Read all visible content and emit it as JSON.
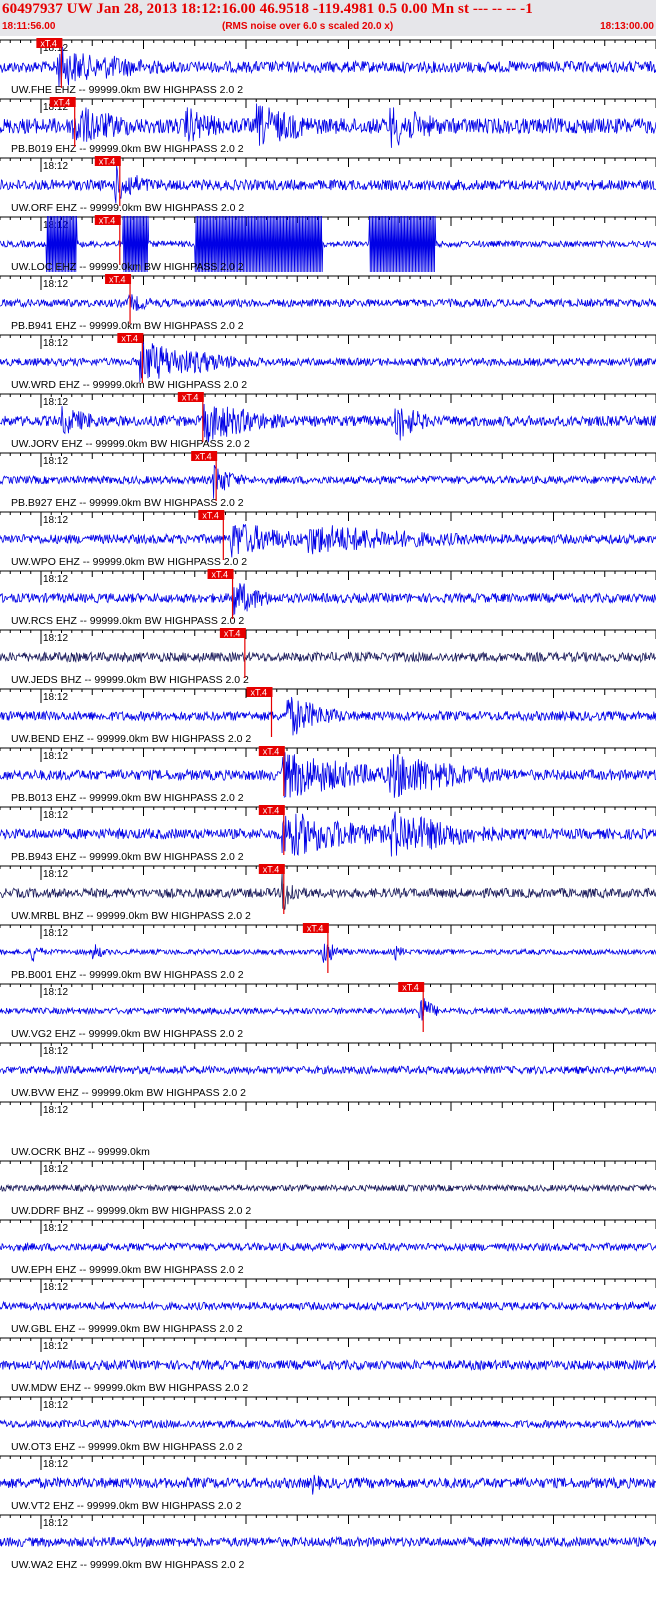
{
  "header": {
    "title": "60497937 UW Jan 28, 2013 18:12:16.00   46.9518 -119.4981  0.5 0.00 Mn st --- -- -- -1",
    "time_start": "18:11:56.00",
    "rms_note": "(RMS noise over 6.0 s scaled 20.0 x)",
    "time_end": "18:13:00.00"
  },
  "chart_data": {
    "type": "line",
    "time_range": [
      "18:11:56.00",
      "18:13:00.00"
    ],
    "minute_label": "18:12",
    "pick_label": "xT.4",
    "colors": {
      "trace": "#0000e6",
      "trace_dark": "#1a1a5a",
      "pick": "#e60000",
      "axis": "#000000"
    },
    "traces": [
      {
        "label": "UW.FHE EHZ -- 99999.0km BW  HIGHPASS  2.0  2",
        "pick_s": 5.5,
        "noise": 0.22,
        "bursts": [
          [
            5.5,
            5,
            0.9
          ],
          [
            10,
            8,
            0.5
          ]
        ],
        "color": "trace"
      },
      {
        "label": "PB.B019 EHZ -- 99999.0km BW  HIGHPASS  2.0  2",
        "pick_s": 6.8,
        "noise": 0.3,
        "bursts": [
          [
            7,
            6,
            0.9
          ],
          [
            18,
            4,
            0.8
          ],
          [
            25,
            6,
            0.9
          ],
          [
            38,
            5,
            0.9
          ]
        ],
        "color": "trace"
      },
      {
        "label": "UW.ORF EHZ -- 99999.0km BW  HIGHPASS  2.0  2",
        "pick_s": 11.2,
        "noise": 0.2,
        "bursts": [
          [
            11.2,
            3,
            0.8
          ]
        ],
        "color": "trace"
      },
      {
        "label": "UW.LOC EHZ -- 99999.0km BW  HIGHPASS  2.0  2",
        "pick_s": 11.2,
        "noise": 0.12,
        "bursts": [],
        "saturated": [
          [
            4.5,
            7.5
          ],
          [
            12.0,
            14.5
          ],
          [
            19.0,
            31.5
          ],
          [
            36.0,
            42.5
          ]
        ],
        "color": "trace"
      },
      {
        "label": "PB.B941 EHZ -- 99999.0km BW  HIGHPASS  2.0  2",
        "pick_s": 12.2,
        "noise": 0.15,
        "bursts": [
          [
            12.5,
            3,
            0.4
          ]
        ],
        "color": "trace"
      },
      {
        "label": "UW.WRD EHZ -- 99999.0km BW  HIGHPASS  2.0  2",
        "pick_s": 13.4,
        "noise": 0.15,
        "bursts": [
          [
            13.6,
            7,
            0.9
          ],
          [
            19,
            5,
            0.5
          ]
        ],
        "color": "trace"
      },
      {
        "label": "UW.JORV EHZ -- 99999.0km BW  HIGHPASS  2.0  2",
        "pick_s": 19.3,
        "noise": 0.2,
        "bursts": [
          [
            6,
            4,
            0.6
          ],
          [
            19.8,
            6,
            0.9
          ],
          [
            38.5,
            2.5,
            0.95
          ]
        ],
        "color": "trace"
      },
      {
        "label": "PB.B927 EHZ -- 99999.0km BW  HIGHPASS  2.0  2",
        "pick_s": 20.6,
        "noise": 0.15,
        "bursts": [
          [
            20.7,
            2,
            0.8
          ]
        ],
        "color": "trace"
      },
      {
        "label": "UW.WPO EHZ -- 99999.0km BW  HIGHPASS  2.0  2",
        "pick_s": 21.3,
        "noise": 0.18,
        "bursts": [
          [
            22.5,
            6,
            0.8
          ],
          [
            30,
            14,
            0.65
          ]
        ],
        "color": "trace"
      },
      {
        "label": "UW.RCS EHZ -- 99999.0km BW  HIGHPASS  2.0  2",
        "pick_s": 22.2,
        "noise": 0.18,
        "bursts": [
          [
            22.6,
            3,
            0.85
          ]
        ],
        "color": "trace"
      },
      {
        "label": "UW.JEDS BHZ -- 99999.0km BW  HIGHPASS  2.0  2",
        "pick_s": 23.4,
        "noise": 0.18,
        "bursts": [],
        "color": "trace_dark"
      },
      {
        "label": "UW.BEND EHZ -- 99999.0km BW  HIGHPASS  2.0  2",
        "pick_s": 26.0,
        "noise": 0.18,
        "bursts": [
          [
            28,
            4,
            0.9
          ]
        ],
        "color": "trace"
      },
      {
        "label": "PB.B013 EHZ -- 99999.0km BW  HIGHPASS  2.0  2",
        "pick_s": 27.2,
        "noise": 0.2,
        "bursts": [
          [
            27.5,
            9,
            1.0
          ],
          [
            38,
            8,
            1.0
          ]
        ],
        "color": "trace"
      },
      {
        "label": "PB.B943 EHZ -- 99999.0km BW  HIGHPASS  2.0  2",
        "pick_s": 27.2,
        "noise": 0.2,
        "bursts": [
          [
            27.5,
            9,
            1.0
          ],
          [
            38,
            8,
            1.0
          ]
        ],
        "color": "trace"
      },
      {
        "label": "UW.MRBL BHZ -- 99999.0km BW  HIGHPASS  2.0  2",
        "pick_s": 27.2,
        "noise": 0.18,
        "bursts": [
          [
            27.5,
            1.5,
            0.9
          ]
        ],
        "color": "trace_dark"
      },
      {
        "label": "PB.B001 EHZ -- 99999.0km BW  HIGHPASS  2.0  2",
        "pick_s": 31.5,
        "noise": 0.1,
        "bursts": [
          [
            31.4,
            1.5,
            0.6
          ],
          [
            3,
            1,
            0.5
          ],
          [
            9,
            1,
            0.45
          ],
          [
            38.5,
            1,
            0.35
          ]
        ],
        "color": "trace"
      },
      {
        "label": "UW.VG2 EHZ -- 99999.0km BW  HIGHPASS  2.0  2",
        "pick_s": 40.8,
        "noise": 0.12,
        "bursts": [
          [
            40.8,
            1.2,
            0.9
          ]
        ],
        "color": "trace"
      },
      {
        "label": "UW.BVW EHZ -- 99999.0km BW  HIGHPASS  2.0  2",
        "pick_s": null,
        "noise": 0.15,
        "bursts": [],
        "color": "trace"
      },
      {
        "label": "UW.OCRK BHZ -- 99999.0km",
        "pick_s": null,
        "noise": 0.0,
        "bursts": [],
        "color": "trace"
      },
      {
        "label": "UW.DDRF BHZ -- 99999.0km BW  HIGHPASS  2.0  2",
        "pick_s": null,
        "noise": 0.12,
        "bursts": [],
        "color": "trace_dark"
      },
      {
        "label": "UW.EPH EHZ -- 99999.0km BW  HIGHPASS  2.0  2",
        "pick_s": null,
        "noise": 0.15,
        "bursts": [],
        "color": "trace"
      },
      {
        "label": "UW.GBL EHZ -- 99999.0km BW  HIGHPASS  2.0  2",
        "pick_s": null,
        "noise": 0.15,
        "bursts": [],
        "color": "trace"
      },
      {
        "label": "UW.MDW EHZ -- 99999.0km BW  HIGHPASS  2.0  2",
        "pick_s": null,
        "noise": 0.18,
        "bursts": [],
        "color": "trace"
      },
      {
        "label": "UW.OT3 EHZ -- 99999.0km BW  HIGHPASS  2.0  2",
        "pick_s": null,
        "noise": 0.15,
        "bursts": [],
        "color": "trace"
      },
      {
        "label": "UW.VT2 EHZ -- 99999.0km BW  HIGHPASS  2.0  2",
        "pick_s": null,
        "noise": 0.2,
        "bursts": [
          [
            30.5,
            1,
            0.5
          ]
        ],
        "color": "trace"
      },
      {
        "label": "UW.WA2 EHZ -- 99999.0km BW  HIGHPASS  2.0  2",
        "pick_s": null,
        "noise": 0.18,
        "bursts": [],
        "color": "trace"
      }
    ]
  }
}
